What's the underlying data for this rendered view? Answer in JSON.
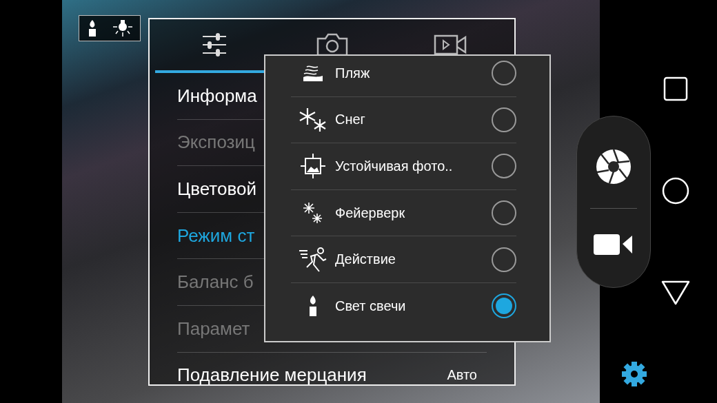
{
  "tabs": [
    {
      "selected": true
    },
    {
      "selected": false
    },
    {
      "selected": false
    }
  ],
  "settings": [
    {
      "label": "Информа",
      "disabled": false,
      "selected": false
    },
    {
      "label": "Экспозиц",
      "disabled": true,
      "selected": false
    },
    {
      "label": "Цветовой",
      "disabled": false,
      "selected": false
    },
    {
      "label": "Режим ст",
      "disabled": false,
      "selected": true
    },
    {
      "label": "Баланс б",
      "disabled": true,
      "selected": false
    },
    {
      "label": "Парамет",
      "disabled": true,
      "selected": false
    },
    {
      "label": "Подавление мерцания",
      "value": "Авто",
      "disabled": false,
      "selected": false
    }
  ],
  "scene_modes": [
    {
      "label": "Пляж",
      "selected": false
    },
    {
      "label": "Снег",
      "selected": false
    },
    {
      "label": "Устойчивая фото..",
      "selected": false
    },
    {
      "label": "Фейерверк",
      "selected": false
    },
    {
      "label": "Действие",
      "selected": false
    },
    {
      "label": "Свет свечи",
      "selected": true
    }
  ]
}
